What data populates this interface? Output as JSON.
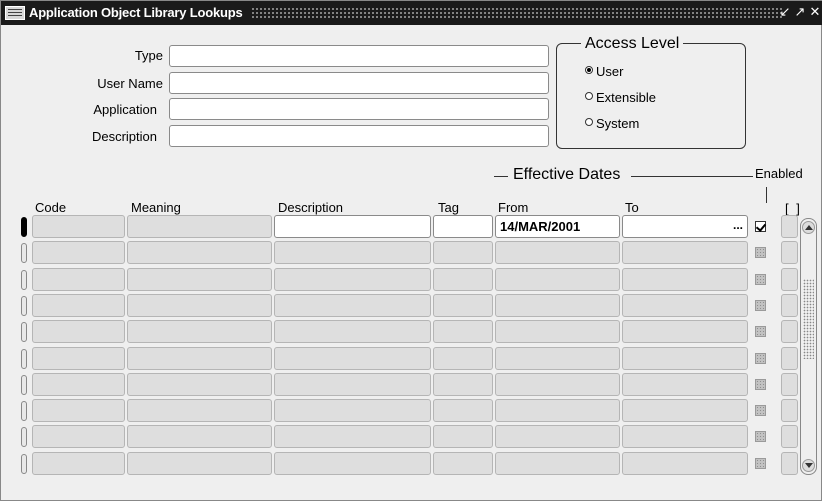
{
  "window": {
    "title": "Application Object Library Lookups",
    "controls": [
      "minimize-icon",
      "restore-icon",
      "close-icon"
    ]
  },
  "header_form": {
    "fields": [
      {
        "label": "Type",
        "value": ""
      },
      {
        "label": "User Name",
        "value": ""
      },
      {
        "label": "Application",
        "value": ""
      },
      {
        "label": "Description",
        "value": ""
      }
    ]
  },
  "access_level": {
    "title": "Access Level",
    "options": [
      {
        "label": "User",
        "selected": true
      },
      {
        "label": "Extensible",
        "selected": false
      },
      {
        "label": "System",
        "selected": false
      }
    ]
  },
  "grid": {
    "group_title": "Effective Dates",
    "enabled_label": "Enabled",
    "flex_label": "[ ]",
    "columns": [
      "Code",
      "Meaning",
      "Description",
      "Tag",
      "From",
      "To"
    ],
    "rows": [
      {
        "code": "",
        "meaning": "",
        "description": "",
        "tag": "",
        "from": "14/MAR/2001",
        "to": "",
        "enabled": true,
        "current": true
      },
      {
        "code": "",
        "meaning": "",
        "description": "",
        "tag": "",
        "from": "",
        "to": "",
        "enabled": false,
        "current": false
      },
      {
        "code": "",
        "meaning": "",
        "description": "",
        "tag": "",
        "from": "",
        "to": "",
        "enabled": false,
        "current": false
      },
      {
        "code": "",
        "meaning": "",
        "description": "",
        "tag": "",
        "from": "",
        "to": "",
        "enabled": false,
        "current": false
      },
      {
        "code": "",
        "meaning": "",
        "description": "",
        "tag": "",
        "from": "",
        "to": "",
        "enabled": false,
        "current": false
      },
      {
        "code": "",
        "meaning": "",
        "description": "",
        "tag": "",
        "from": "",
        "to": "",
        "enabled": false,
        "current": false
      },
      {
        "code": "",
        "meaning": "",
        "description": "",
        "tag": "",
        "from": "",
        "to": "",
        "enabled": false,
        "current": false
      },
      {
        "code": "",
        "meaning": "",
        "description": "",
        "tag": "",
        "from": "",
        "to": "",
        "enabled": false,
        "current": false
      },
      {
        "code": "",
        "meaning": "",
        "description": "",
        "tag": "",
        "from": "",
        "to": "",
        "enabled": false,
        "current": false
      },
      {
        "code": "",
        "meaning": "",
        "description": "",
        "tag": "",
        "from": "",
        "to": "",
        "enabled": false,
        "current": false
      }
    ],
    "lov_button": "..."
  }
}
